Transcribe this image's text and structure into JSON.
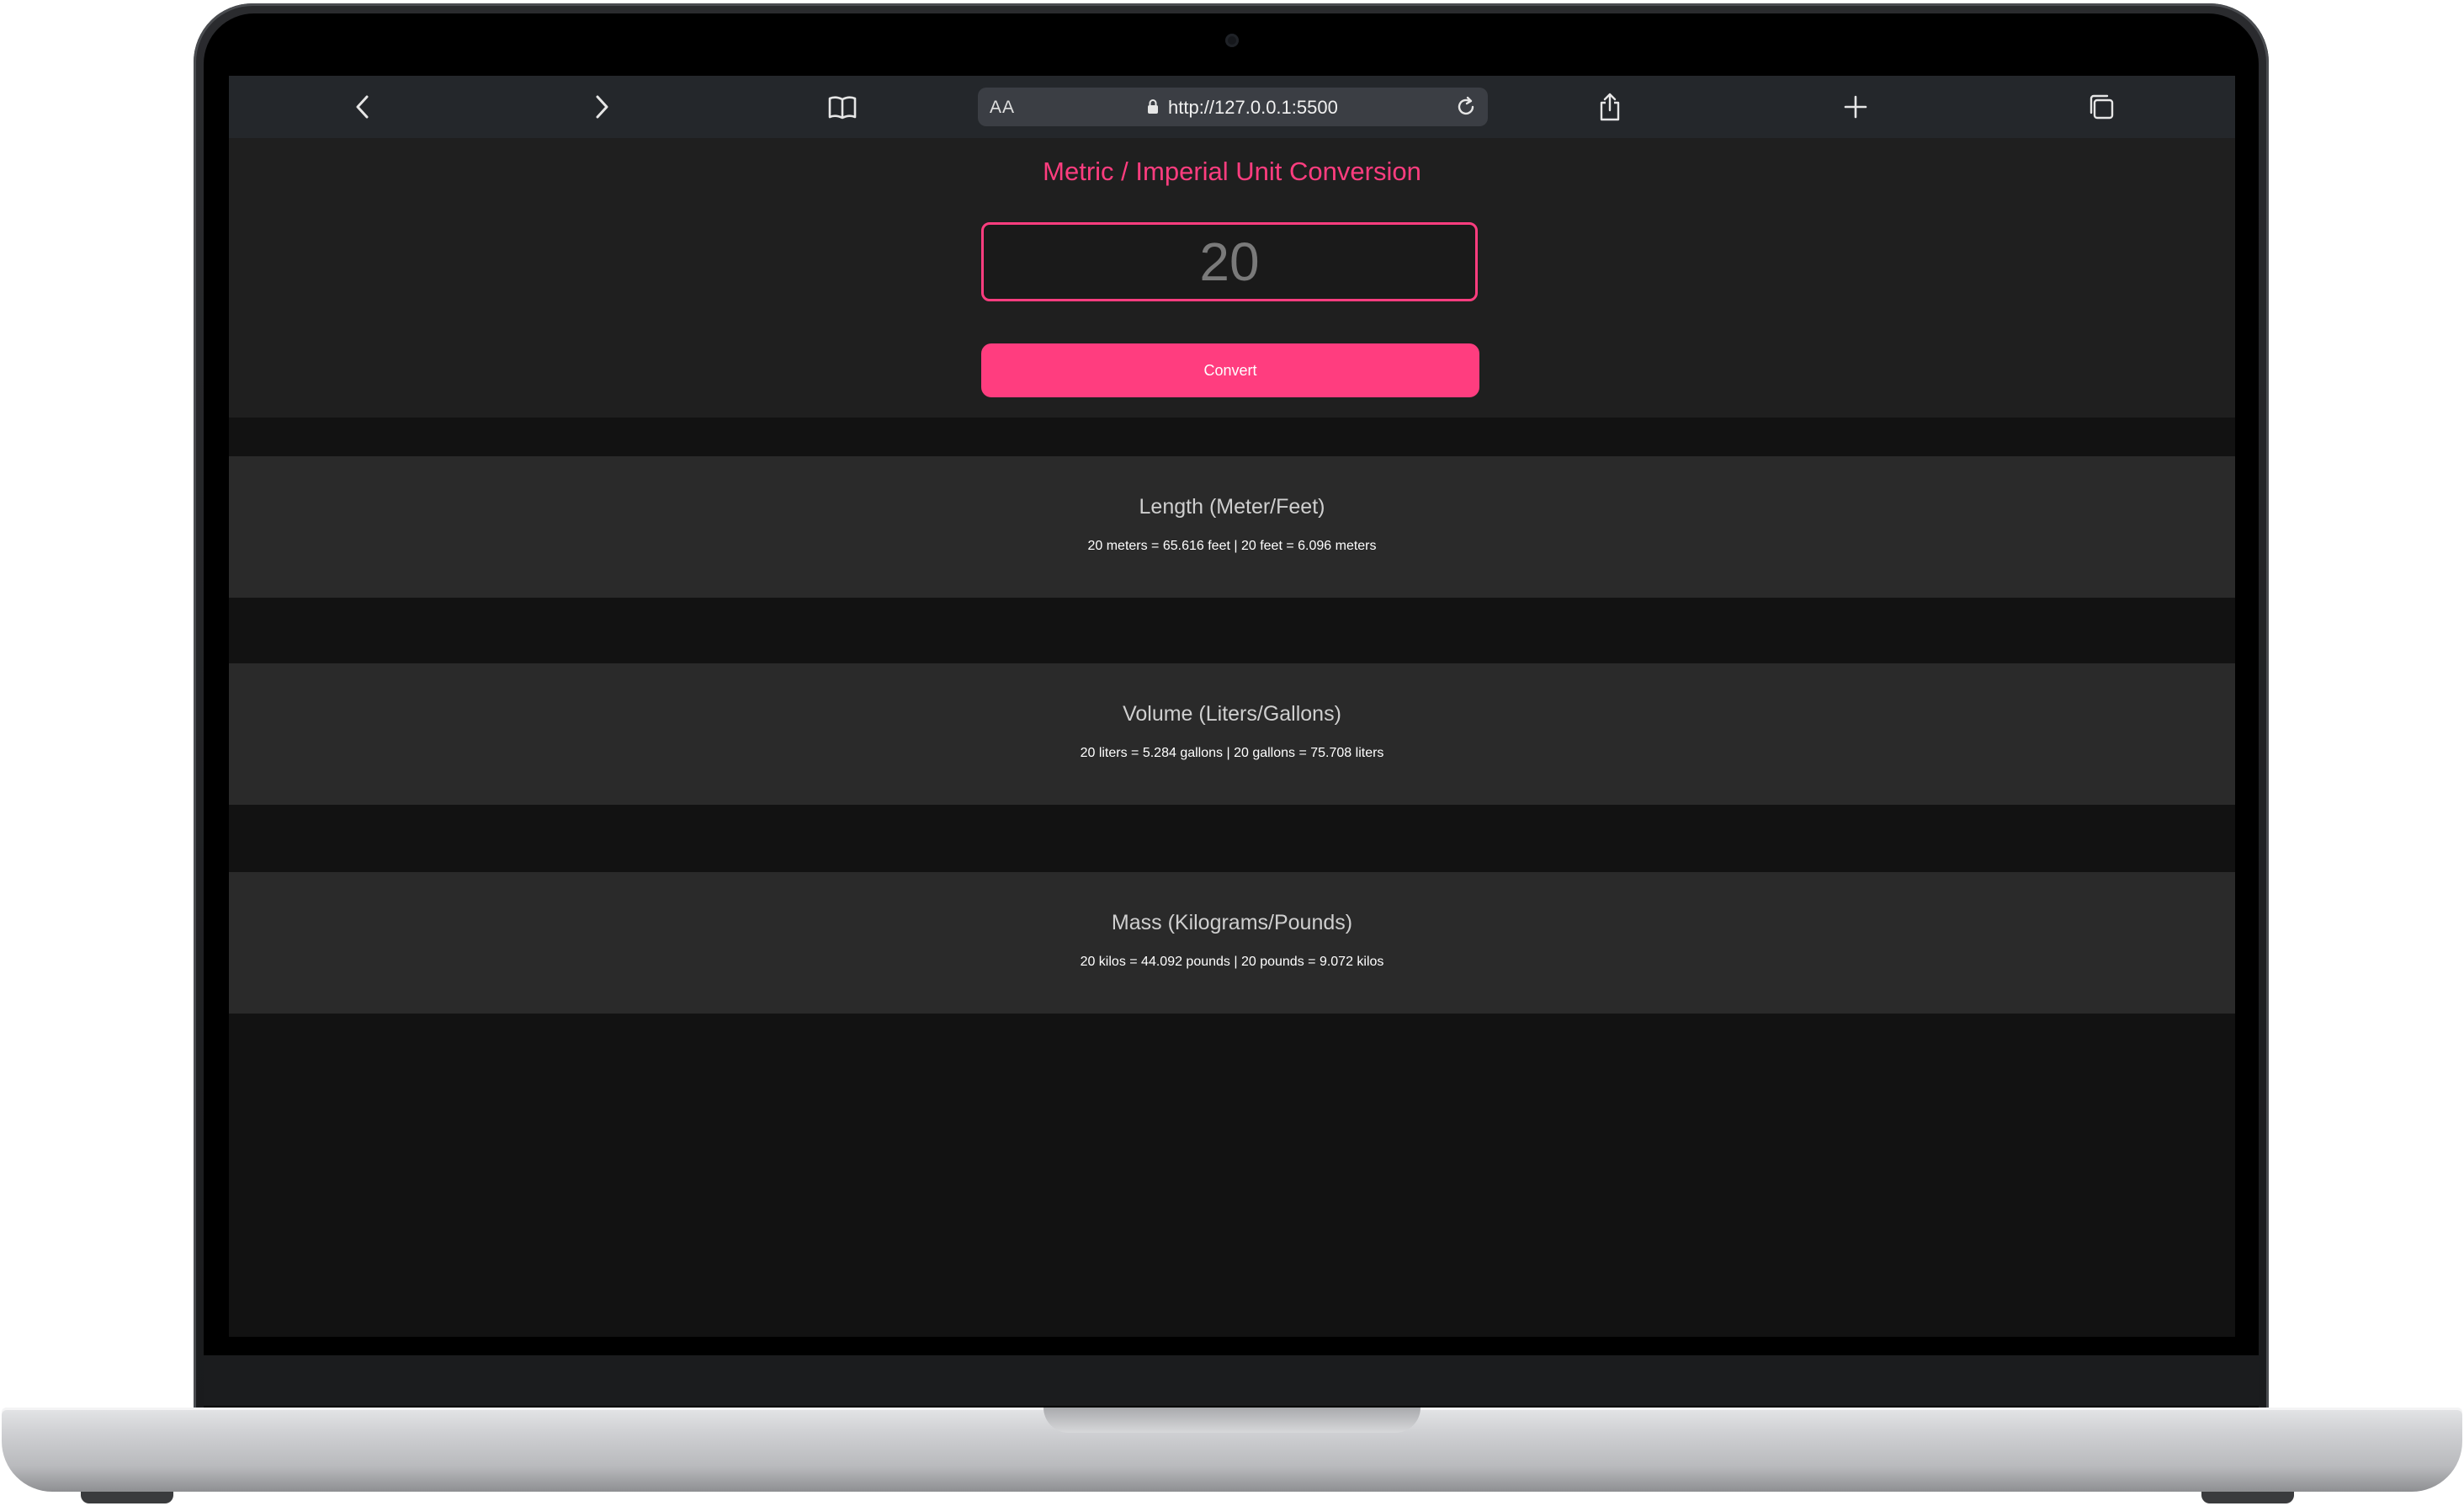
{
  "browser": {
    "text_size_label": "AA",
    "url": "http://127.0.0.1:5500"
  },
  "app": {
    "title": "Metric / Imperial Unit Conversion",
    "input_value": "20",
    "convert_label": "Convert"
  },
  "conversions": [
    {
      "title": "Length (Meter/Feet)",
      "result": "20 meters = 65.616 feet | 20 feet = 6.096 meters"
    },
    {
      "title": "Volume (Liters/Gallons)",
      "result": "20 liters = 5.284 gallons | 20 gallons = 75.708 liters"
    },
    {
      "title": "Mass (Kilograms/Pounds)",
      "result": "20 kilos = 44.092 pounds | 20 pounds = 9.072 kilos"
    }
  ],
  "colors": {
    "accent": "#ff3d7f",
    "page_background": "#121212",
    "hero_background": "#1f1f1f",
    "card_background": "#2a2a2a",
    "toolbar_background": "#24272b"
  }
}
